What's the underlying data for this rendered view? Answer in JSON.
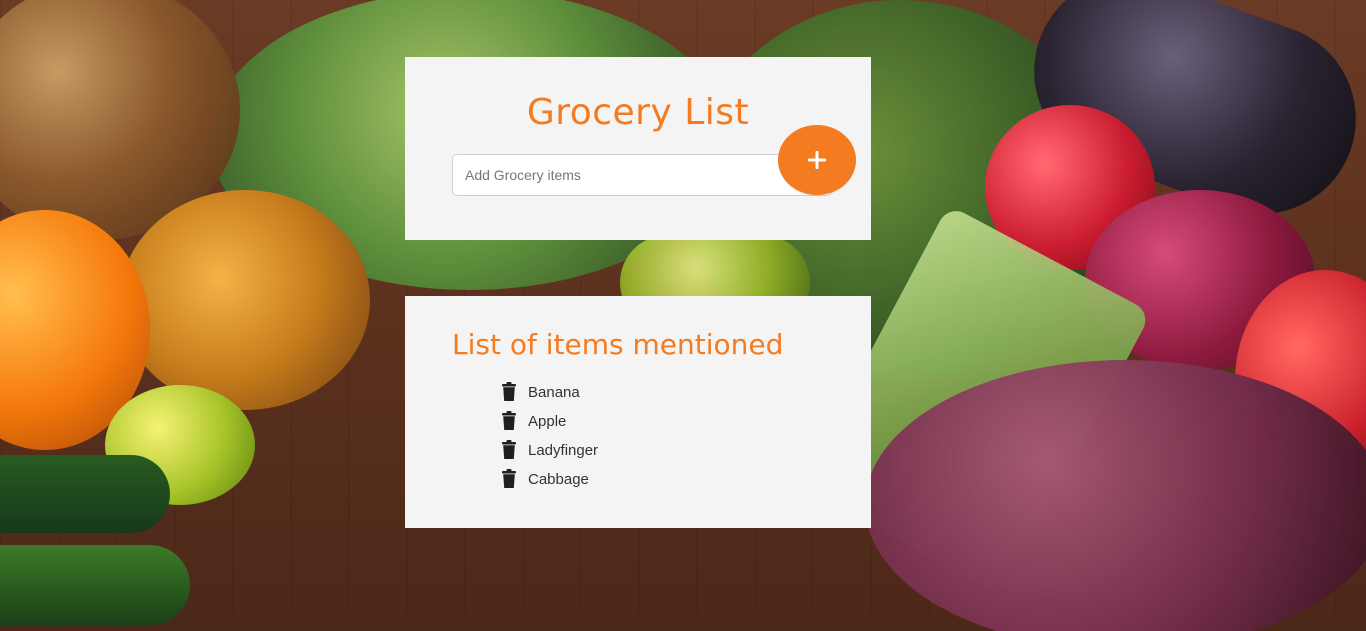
{
  "page": {
    "background": "fresh produce on wooden table"
  },
  "brand": {
    "accent_color": "#f57b20",
    "card_background": "#f4f4f4"
  },
  "add_card": {
    "title": "Grocery List",
    "input": {
      "placeholder": "Add Grocery items",
      "value": ""
    },
    "add_button": {
      "label": "+",
      "icon": "plus-icon"
    }
  },
  "list_card": {
    "heading": "List of items mentioned",
    "items": [
      {
        "label": "Banana",
        "icon": "trash-icon"
      },
      {
        "label": "Apple",
        "icon": "trash-icon"
      },
      {
        "label": "Ladyfinger",
        "icon": "trash-icon"
      },
      {
        "label": "Cabbage",
        "icon": "trash-icon"
      }
    ]
  }
}
